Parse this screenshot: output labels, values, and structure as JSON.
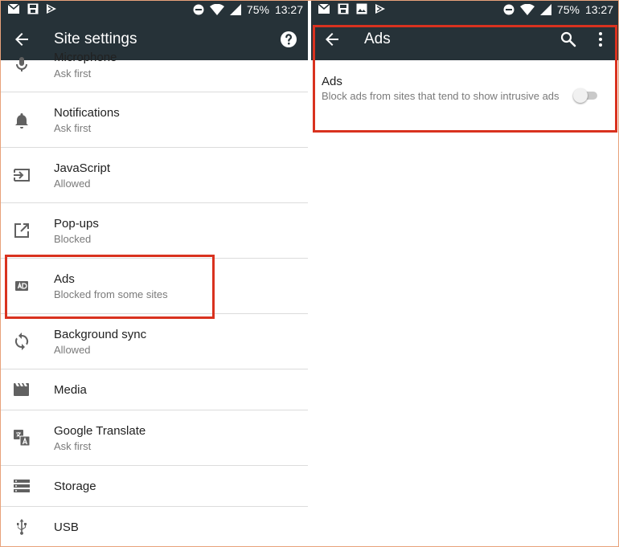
{
  "status": {
    "battery": "75%",
    "time": "13:27"
  },
  "left": {
    "title": "Site settings",
    "items": [
      {
        "title": "Microphone",
        "subtitle": "Ask first",
        "icon": "mic-icon"
      },
      {
        "title": "Notifications",
        "subtitle": "Ask first",
        "icon": "bell-icon"
      },
      {
        "title": "JavaScript",
        "subtitle": "Allowed",
        "icon": "javascript-icon"
      },
      {
        "title": "Pop-ups",
        "subtitle": "Blocked",
        "icon": "popup-icon"
      },
      {
        "title": "Ads",
        "subtitle": "Blocked from some sites",
        "icon": "ads-icon"
      },
      {
        "title": "Background sync",
        "subtitle": "Allowed",
        "icon": "sync-icon"
      },
      {
        "title": "Media",
        "icon": "media-icon"
      },
      {
        "title": "Google Translate",
        "subtitle": "Ask first",
        "icon": "translate-icon"
      },
      {
        "title": "Storage",
        "icon": "storage-icon"
      },
      {
        "title": "USB",
        "icon": "usb-icon"
      }
    ]
  },
  "right": {
    "title": "Ads",
    "setting": {
      "title": "Ads",
      "description": "Block ads from sites that tend to show intrusive ads",
      "enabled": false
    }
  },
  "colors": {
    "toolbar": "#263238",
    "highlight": "#d9321f"
  }
}
